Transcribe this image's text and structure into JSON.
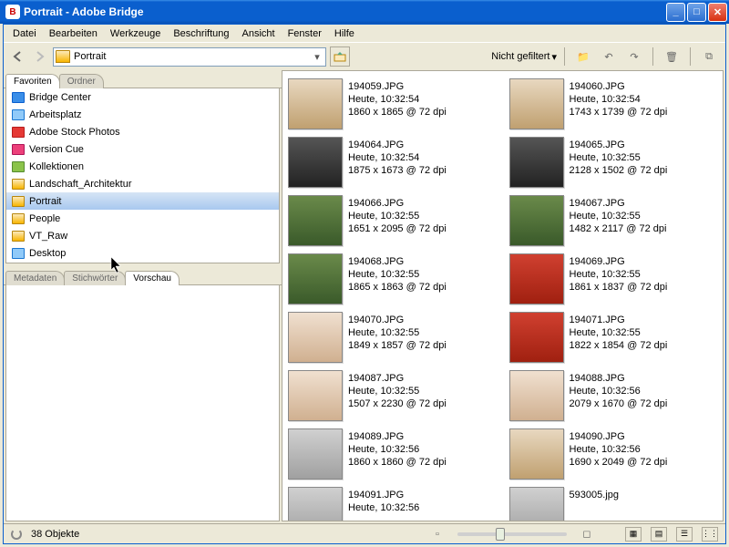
{
  "window": {
    "title": "Portrait - Adobe Bridge"
  },
  "menu": [
    "Datei",
    "Bearbeiten",
    "Werkzeuge",
    "Beschriftung",
    "Ansicht",
    "Fenster",
    "Hilfe"
  ],
  "toolbar": {
    "path": "Portrait",
    "filter_label": "Nicht gefiltert"
  },
  "left_tabs": {
    "tab1": "Favoriten",
    "tab2": "Ordner"
  },
  "favorites": [
    {
      "label": "Bridge Center",
      "icon": "app"
    },
    {
      "label": "Arbeitsplatz",
      "icon": "mon"
    },
    {
      "label": "Adobe Stock Photos",
      "icon": "red"
    },
    {
      "label": "Version Cue",
      "icon": "pink"
    },
    {
      "label": "Kollektionen",
      "icon": "stack"
    },
    {
      "label": "Landschaft_Architektur",
      "icon": "folder"
    },
    {
      "label": "Portrait",
      "icon": "folder",
      "selected": true
    },
    {
      "label": "People",
      "icon": "folder"
    },
    {
      "label": "VT_Raw",
      "icon": "folder"
    },
    {
      "label": "Desktop",
      "icon": "mon"
    }
  ],
  "mid_tabs": {
    "tab1": "Metadaten",
    "tab2": "Stichwörter",
    "tab3": "Vorschau"
  },
  "files": [
    {
      "name": "194059.JPG",
      "date": "Heute, 10:32:54",
      "dim": "1860 x 1865 @ 72 dpi",
      "c": "c1"
    },
    {
      "name": "194060.JPG",
      "date": "Heute, 10:32:54",
      "dim": "1743 x 1739 @ 72 dpi",
      "c": "c1"
    },
    {
      "name": "194064.JPG",
      "date": "Heute, 10:32:54",
      "dim": "1875 x 1673 @ 72 dpi",
      "c": "c2"
    },
    {
      "name": "194065.JPG",
      "date": "Heute, 10:32:55",
      "dim": "2128 x 1502 @ 72 dpi",
      "c": "c2"
    },
    {
      "name": "194066.JPG",
      "date": "Heute, 10:32:55",
      "dim": "1651 x 2095 @ 72 dpi",
      "c": "c3"
    },
    {
      "name": "194067.JPG",
      "date": "Heute, 10:32:55",
      "dim": "1482 x 2117 @ 72 dpi",
      "c": "c3"
    },
    {
      "name": "194068.JPG",
      "date": "Heute, 10:32:55",
      "dim": "1865 x 1863 @ 72 dpi",
      "c": "c3"
    },
    {
      "name": "194069.JPG",
      "date": "Heute, 10:32:55",
      "dim": "1861 x 1837 @ 72 dpi",
      "c": "c5"
    },
    {
      "name": "194070.JPG",
      "date": "Heute, 10:32:55",
      "dim": "1849 x 1857 @ 72 dpi",
      "c": "c6"
    },
    {
      "name": "194071.JPG",
      "date": "Heute, 10:32:55",
      "dim": "1822 x 1854 @ 72 dpi",
      "c": "c5"
    },
    {
      "name": "194087.JPG",
      "date": "Heute, 10:32:55",
      "dim": "1507 x 2230 @ 72 dpi",
      "c": "c6"
    },
    {
      "name": "194088.JPG",
      "date": "Heute, 10:32:56",
      "dim": "2079 x 1670 @ 72 dpi",
      "c": "c6"
    },
    {
      "name": "194089.JPG",
      "date": "Heute, 10:32:56",
      "dim": "1860 x 1860 @ 72 dpi",
      "c": "c4"
    },
    {
      "name": "194090.JPG",
      "date": "Heute, 10:32:56",
      "dim": "1690 x 2049 @ 72 dpi",
      "c": "c1"
    },
    {
      "name": "194091.JPG",
      "date": "Heute, 10:32:56",
      "dim": "",
      "c": "c4"
    },
    {
      "name": "593005.jpg",
      "date": "",
      "dim": "",
      "c": "c4"
    }
  ],
  "status": {
    "count": "38 Objekte"
  }
}
